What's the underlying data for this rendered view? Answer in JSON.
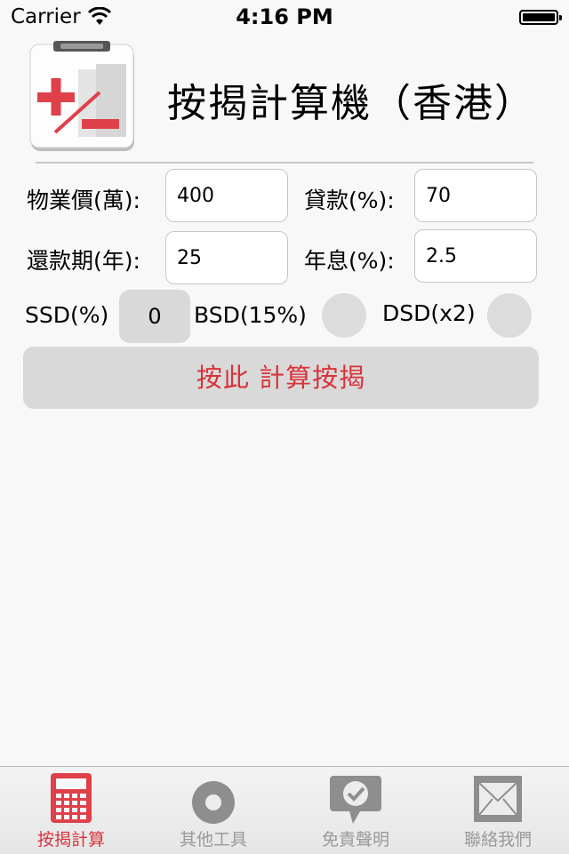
{
  "status_bar": {
    "carrier": "Carrier",
    "time": "4:16 PM"
  },
  "header": {
    "title": "按揭計算機（香港）"
  },
  "form": {
    "price_label": "物業價(萬):",
    "price_value": "400",
    "loan_label": "貸款(%):",
    "loan_value": "70",
    "term_label": "還款期(年):",
    "term_value": "25",
    "rate_label": "年息(%):",
    "rate_value": "2.5",
    "ssd_label": "SSD(%)",
    "ssd_value": "0",
    "bsd_label": "BSD(15%)",
    "dsd_label": "DSD(x2)",
    "calculate_label": "按此 計算按揭"
  },
  "tabs": [
    {
      "label": "按揭計算",
      "icon": "calculator-icon"
    },
    {
      "label": "其他工具",
      "icon": "tools-icon"
    },
    {
      "label": "免責聲明",
      "icon": "disclaimer-icon"
    },
    {
      "label": "聯絡我們",
      "icon": "mail-icon"
    }
  ],
  "colors": {
    "accent": "#d9323a",
    "inactive": "#8e8e8e"
  }
}
